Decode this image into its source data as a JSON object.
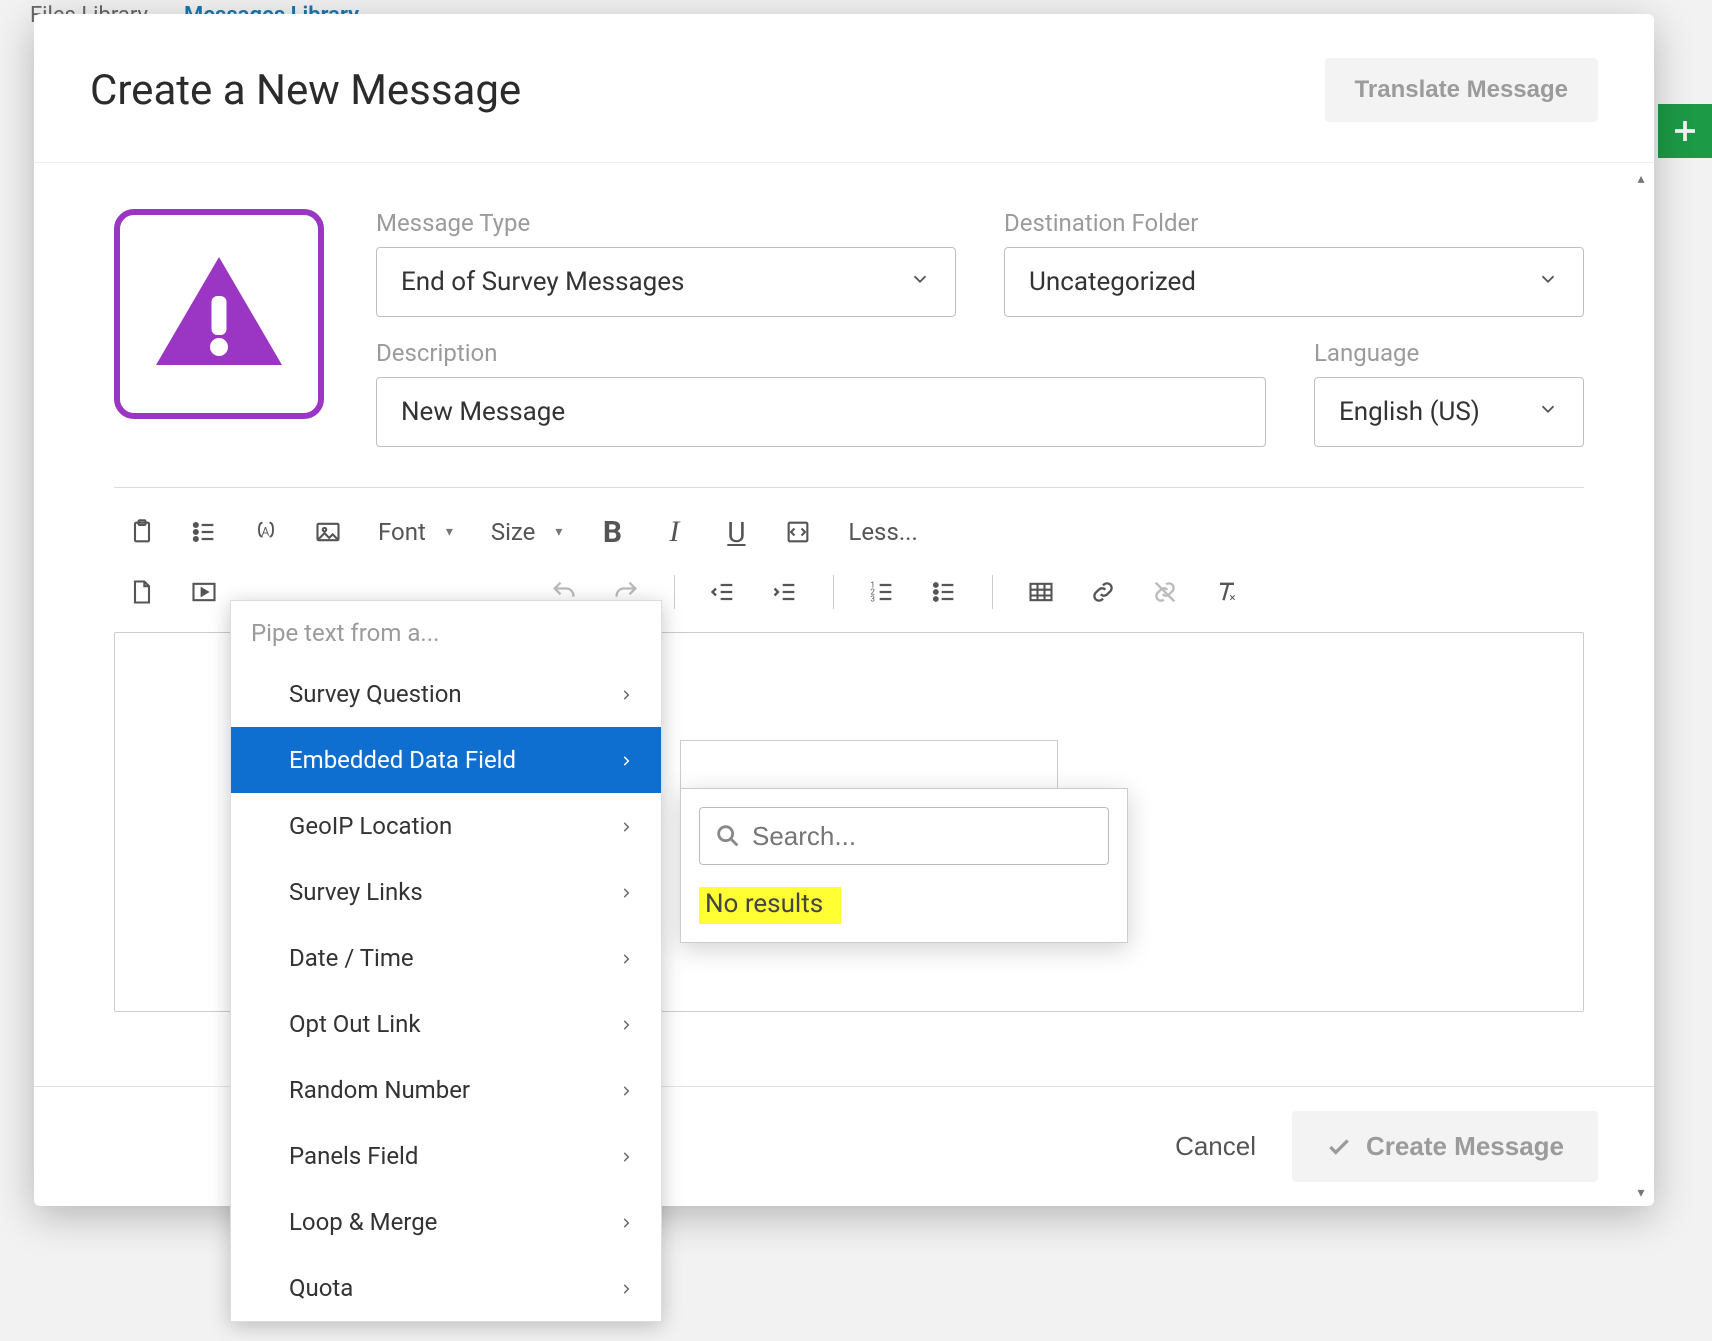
{
  "background": {
    "tab_files": "Files Library",
    "tab_messages": "Messages Library"
  },
  "modal": {
    "title": "Create a New Message",
    "translate_button": "Translate Message",
    "message_type_label": "Message Type",
    "message_type_value": "End of Survey Messages",
    "destination_folder_label": "Destination Folder",
    "destination_folder_value": "Uncategorized",
    "description_label": "Description",
    "description_value": "New Message",
    "language_label": "Language",
    "language_value": "English (US)"
  },
  "toolbar": {
    "font_label": "Font",
    "size_label": "Size",
    "less_label": "Less..."
  },
  "pipe_menu": {
    "header": "Pipe text from a...",
    "items": [
      "Survey Question",
      "Embedded Data Field",
      "GeoIP Location",
      "Survey Links",
      "Date / Time",
      "Opt Out Link",
      "Random Number",
      "Panels Field",
      "Loop & Merge",
      "Quota"
    ],
    "active_index": 1
  },
  "sub_popover": {
    "search_placeholder": "Search...",
    "no_results": "No results"
  },
  "footer": {
    "cancel": "Cancel",
    "create": "Create Message"
  }
}
